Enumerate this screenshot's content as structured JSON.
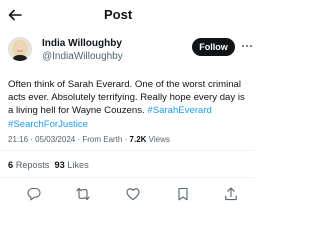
{
  "header": {
    "title": "Post",
    "back_icon": "arrow-left-icon"
  },
  "author": {
    "display_name": "India Willoughby",
    "handle": "@IndiaWilloughby",
    "follow_label": "Follow",
    "more_icon": "more-horizontal-icon"
  },
  "post": {
    "text_main": "Often think of Sarah Everard. One of the worst criminal acts ever. Absolutely terrifying. Really hope every day is a living hell for Wayne Couzens. ",
    "hashtags": [
      "#SarahEverard",
      "#SearchForJustice"
    ],
    "time": "21:16",
    "date": "05/03/2024",
    "separator": "·",
    "source": "From Earth",
    "views_count": "7.2K",
    "views_label": "Views"
  },
  "stats": {
    "reposts_count": "6",
    "reposts_label": "Reposts",
    "likes_count": "93",
    "likes_label": "Likes"
  },
  "actions": [
    "reply-icon",
    "repost-icon",
    "like-icon",
    "bookmark-icon",
    "share-icon"
  ],
  "colors": {
    "text": "#0f1419",
    "secondary": "#536471",
    "link": "#1d9bf0",
    "divider": "#eff3f4",
    "follow_bg": "#0f1419"
  }
}
